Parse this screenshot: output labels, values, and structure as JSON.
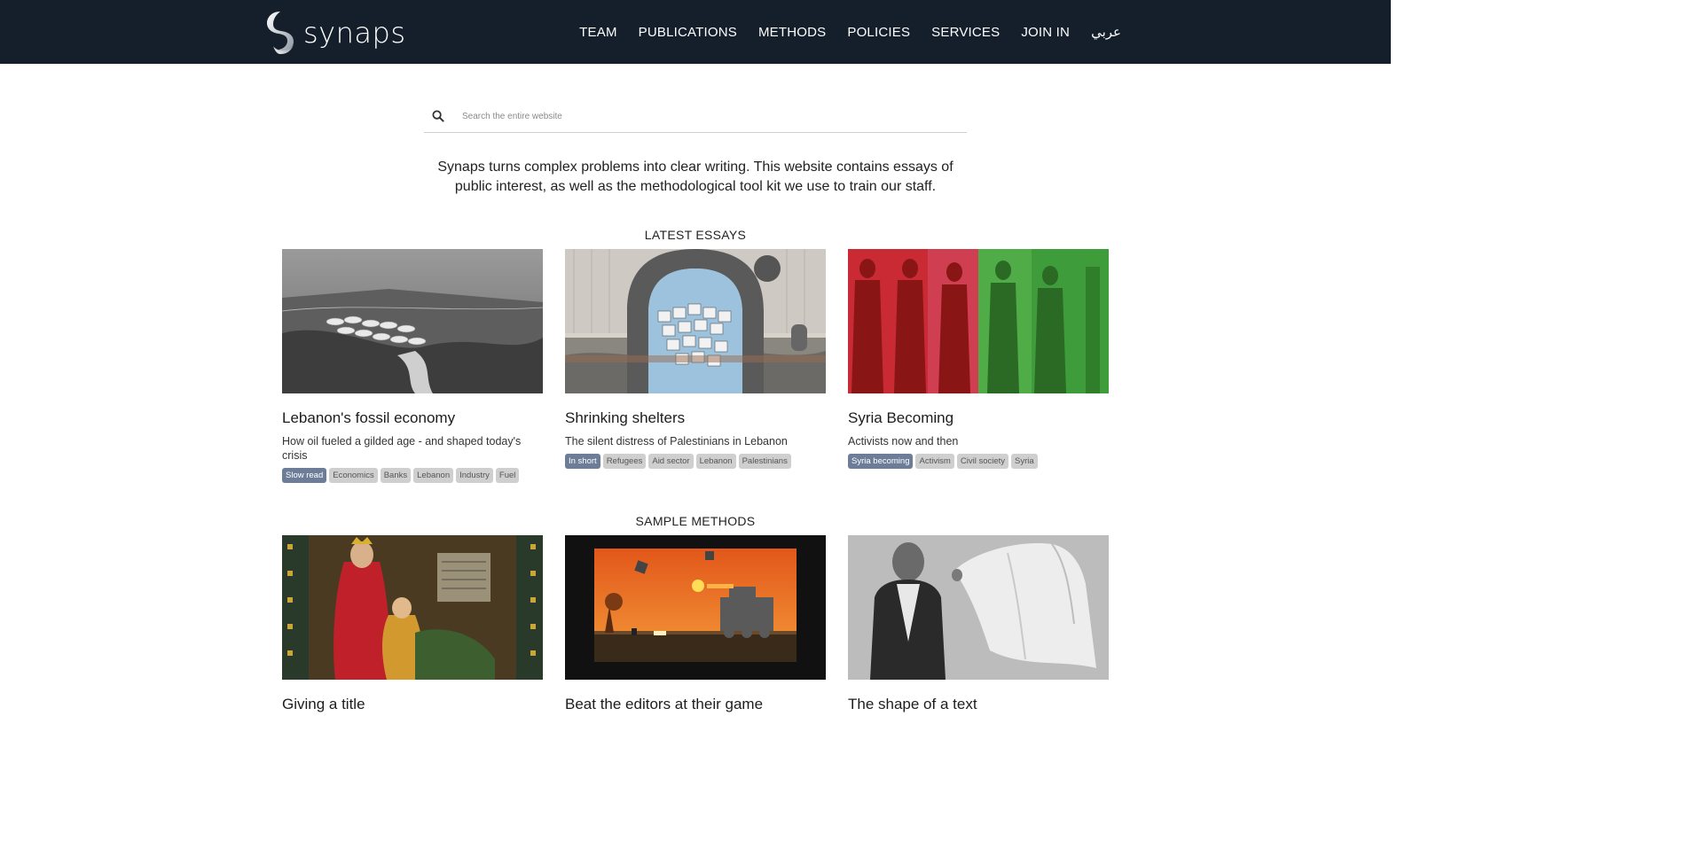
{
  "header": {
    "logo_text": "synaps",
    "nav": [
      "TEAM",
      "PUBLICATIONS",
      "METHODS",
      "POLICIES",
      "SERVICES",
      "JOIN IN",
      "عربي"
    ]
  },
  "search": {
    "placeholder": "Search the entire website",
    "icon": "search-icon"
  },
  "intro": "Synaps turns complex problems into clear writing. This website contains essays of public interest, as well as the methodological tool kit we use to train our staff.",
  "latest_essays": {
    "title": "LATEST ESSAYS",
    "cards": [
      {
        "title": "Lebanon's fossil economy",
        "subtitle": "How oil fueled a gilded age - and shaped today's crisis",
        "tags": [
          "Slow read",
          "Economics",
          "Banks",
          "Lebanon",
          "Industry",
          "Fuel"
        ]
      },
      {
        "title": "Shrinking shelters",
        "subtitle": "The silent distress of Palestinians in Lebanon",
        "tags": [
          "In short",
          "Refugees",
          "Aid sector",
          "Lebanon",
          "Palestinians"
        ]
      },
      {
        "title": "Syria Becoming",
        "subtitle": "Activists now and then",
        "tags": [
          "Syria becoming",
          "Activism",
          "Civil society",
          "Syria"
        ]
      }
    ]
  },
  "sample_methods": {
    "title": "SAMPLE METHODS",
    "cards": [
      {
        "title": "Giving a title"
      },
      {
        "title": "Beat the editors at their game"
      },
      {
        "title": "The shape of a text"
      }
    ]
  },
  "colors": {
    "header_bg": "#141f2b",
    "tag_primary": "#6d7d98",
    "tag_default": "#cfcfcf"
  }
}
